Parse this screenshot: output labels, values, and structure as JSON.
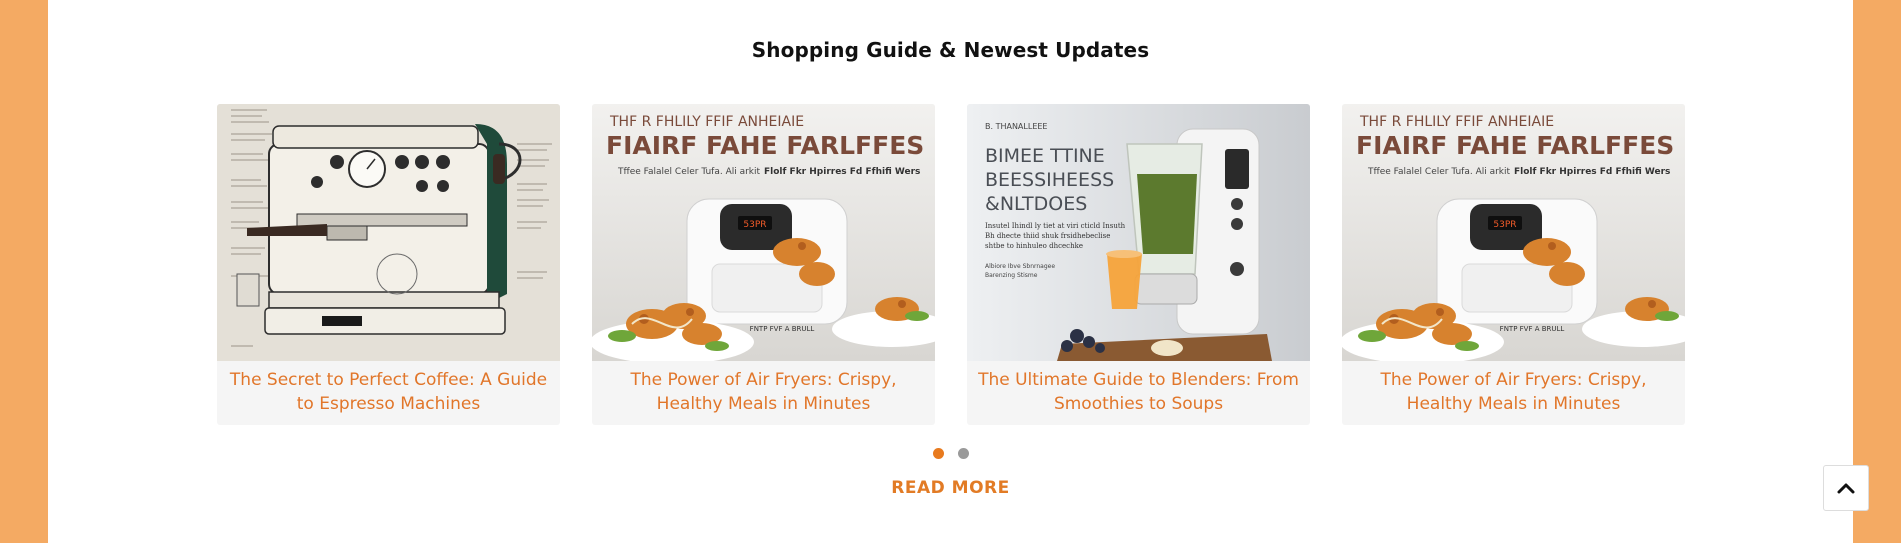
{
  "section": {
    "title": "Shopping Guide & Newest Updates"
  },
  "cards": [
    {
      "title": "The Secret to Perfect Coffee: A Guide to Espresso Machines",
      "image": "espresso-machine-illustration"
    },
    {
      "title": "The Power of Air Fryers: Crispy, Healthy Meals in Minutes",
      "image": "air-fryer-photo",
      "image_text": {
        "top": "THF R FHLILY  FFIF ANHEIAIE",
        "headline": "FIAIRF FAHE FARLFFES",
        "sub": "Tffee Falalel Celer Tufa. Ali arkit",
        "sub_bold": "Flolf Fkr Hpirres Fd Ffhifi Wers",
        "display": "53PR",
        "badge": "FNTP FVF A BRULL"
      }
    },
    {
      "title": "The Ultimate Guide to Blenders: From Smoothies to Soups",
      "image": "blender-photo",
      "image_text": {
        "tag": "B. THANALLEEE",
        "headline_lines": [
          "BIMEE TTINE",
          "BEESSIHEESS",
          "&NLTDOES"
        ],
        "body_lines": [
          "Insutel Ihindl ly tiet at viri cticld Insuth",
          "Bh dhecte thiid shuk frsidhebeclise",
          "shtbe to hinhuleo dhcechke"
        ],
        "foot_lines": [
          "Albiore Ibve Sbnrnagee",
          "Barenzing Stisme"
        ]
      }
    },
    {
      "title": "The Power of Air Fryers: Crispy, Healthy Meals in Minutes",
      "image": "air-fryer-photo",
      "image_text": {
        "top": "THF R FHLILY  FFIF ANHEIAIE",
        "headline": "FIAIRF FAHE FARLFFES",
        "sub": "Tffee Falalel Celer Tufa. Ali arkit",
        "sub_bold": "Flolf Fkr Hpirres Fd Ffhifi Wers",
        "display": "53PR",
        "badge": "FNTP FVF A BRULL"
      }
    }
  ],
  "pagination": {
    "total": 2,
    "active_index": 0
  },
  "read_more": {
    "label": "READ MORE"
  },
  "scroll_top": {
    "icon": "chevron-up-icon"
  },
  "colors": {
    "side_background": "#F4AA63",
    "accent": "#E1762A",
    "card_background": "#F5F5F5",
    "headline_brown": "#7A4A3A"
  }
}
